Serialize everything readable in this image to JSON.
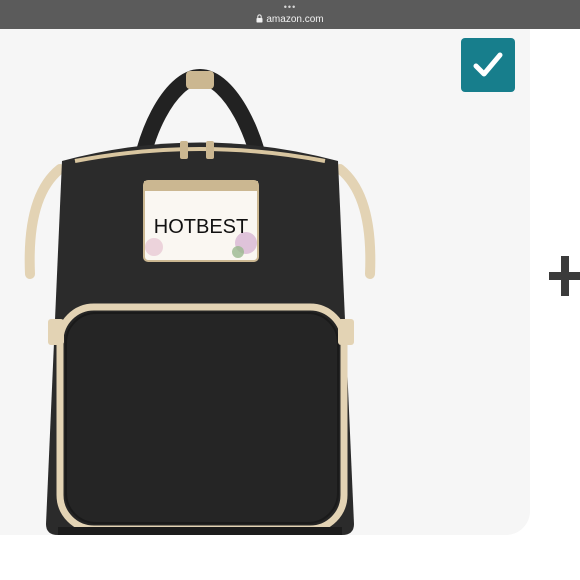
{
  "browser": {
    "dots": "•••",
    "url": "amazon.com"
  },
  "product": {
    "tag_text": "HOTBEST",
    "selected": true,
    "image": "black diaper backpack with beige trim"
  },
  "actions": {
    "add_icon": "plus-icon",
    "select_icon": "checkmark-icon"
  },
  "colors": {
    "check_bg": "#177e8c",
    "bag": "#2b2b2b",
    "trim": "#e3d3b4"
  }
}
